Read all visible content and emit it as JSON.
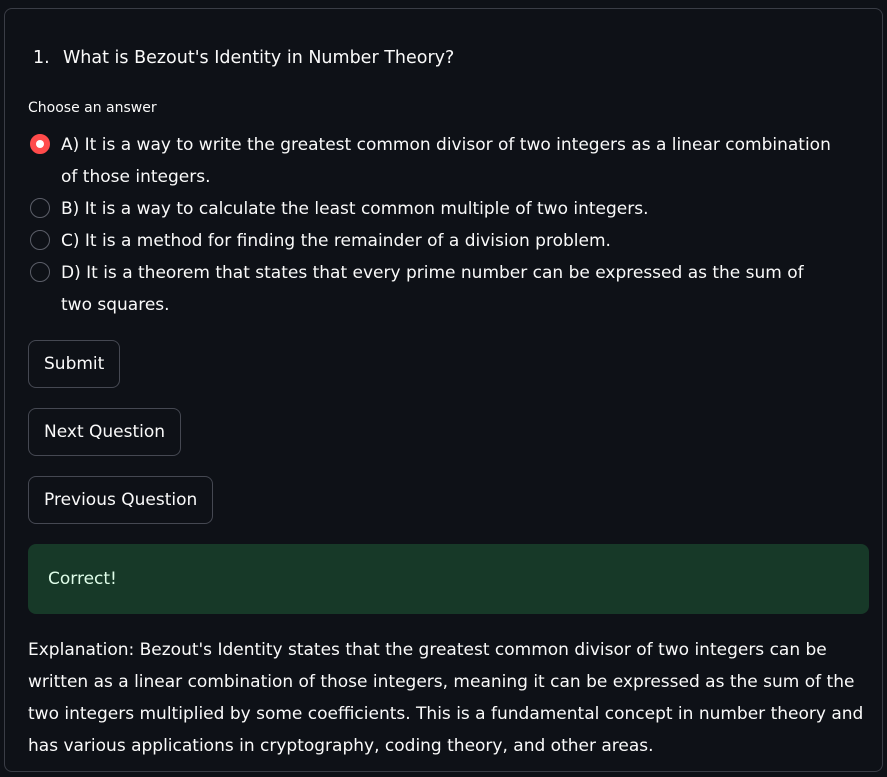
{
  "question": {
    "number": "1.",
    "text": "What is Bezout's Identity in Number Theory?"
  },
  "radio_group": {
    "label": "Choose an answer",
    "selected_index": 0,
    "options": [
      "A) It is a way to write the greatest common divisor of two integers as a linear combination of those integers.",
      "B) It is a way to calculate the least common multiple of two integers.",
      "C) It is a method for finding the remainder of a division problem.",
      "D) It is a theorem that states that every prime number can be expressed as the sum of two squares."
    ]
  },
  "buttons": {
    "submit": "Submit",
    "next": "Next Question",
    "previous": "Previous Question"
  },
  "result": {
    "message": "Correct!",
    "status": "success"
  },
  "explanation": "Explanation: Bezout's Identity states that the greatest common divisor of two integers can be written as a linear combination of those integers, meaning it can be expressed as the sum of the two integers multiplied by some coefficients. This is a fundamental concept in number theory and has various applications in cryptography, coding theory, and other areas.",
  "colors": {
    "background": "#0e1117",
    "accent": "#ff4b4b",
    "success_bg": "#173928",
    "success_text": "#dffde9",
    "text": "#fafafa"
  }
}
